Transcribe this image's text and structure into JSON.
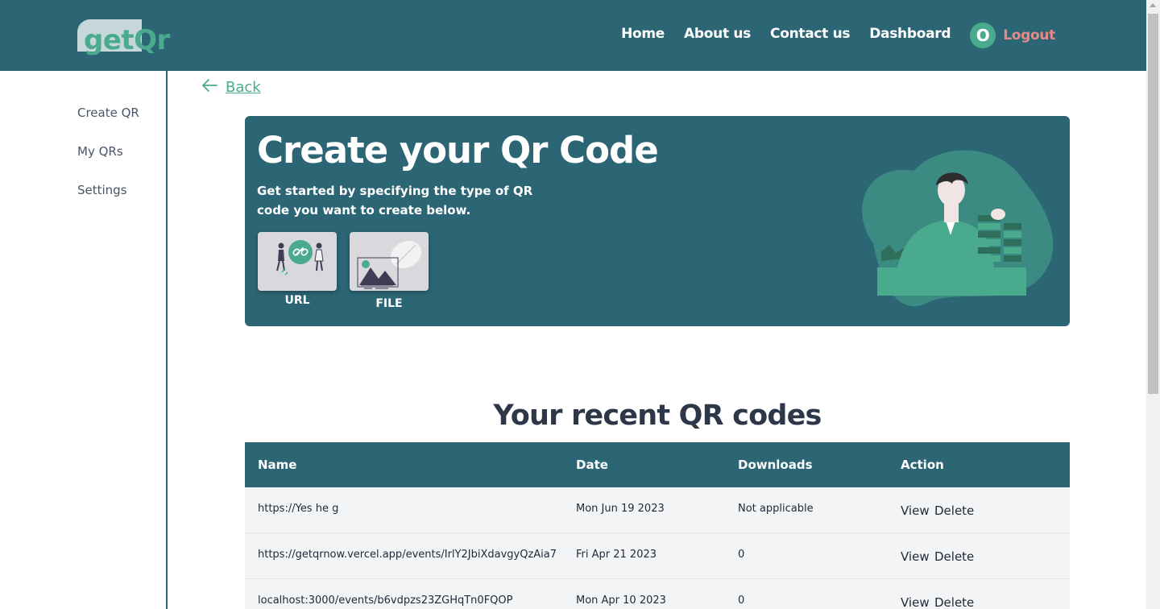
{
  "header": {
    "logo_text": "getQr",
    "nav": [
      "Home",
      "About us",
      "Contact us",
      "Dashboard"
    ],
    "avatar_initial": "O",
    "logout_label": "Logout"
  },
  "sidebar": {
    "items": [
      "Create QR",
      "My QRs",
      "Settings"
    ]
  },
  "back_label": "Back",
  "hero": {
    "title": "Create your Qr Code",
    "subtitle": "Get started by specifying the type of QR code you want to create below.",
    "types": [
      {
        "label": "URL",
        "icon": "url-illustration-icon"
      },
      {
        "label": "FILE",
        "icon": "file-illustration-icon"
      }
    ]
  },
  "recent": {
    "title": "Your recent QR codes",
    "columns": [
      "Name",
      "Date",
      "Downloads",
      "Action"
    ],
    "rows": [
      {
        "name": "https://Yes he g",
        "date": "Mon Jun 19 2023",
        "downloads": "Not applicable",
        "view": "View",
        "delete": "Delete"
      },
      {
        "name": "https://getqrnow.vercel.app/events/IrlY2JbiXdavgyQzAia7",
        "date": "Fri Apr 21 2023",
        "downloads": "0",
        "view": "View",
        "delete": "Delete"
      },
      {
        "name": "localhost:3000/events/b6vdpzs23ZGHqTn0FQOP",
        "date": "Mon Apr 10 2023",
        "downloads": "0",
        "view": "View",
        "delete": "Delete"
      }
    ]
  },
  "colors": {
    "primary": "#2c6675",
    "accent": "#4aaa8d",
    "logout": "#e58a8a"
  }
}
